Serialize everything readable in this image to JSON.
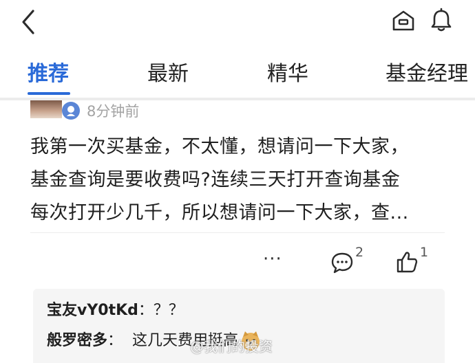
{
  "header": {
    "back_icon": "chevron-left-icon",
    "home_icon": "home-icon",
    "bell_icon": "bell-icon"
  },
  "tabs": [
    {
      "label": "推荐",
      "active": true
    },
    {
      "label": "最新",
      "active": false
    },
    {
      "label": "精华",
      "active": false
    },
    {
      "label": "基金经理",
      "active": false
    }
  ],
  "colors": {
    "accent": "#2a6ad8",
    "badge": "#5b86d6",
    "muted": "#a3a3a3"
  },
  "post": {
    "time": "8分钟前",
    "lines": [
      "我第一次买基金，不太懂，想请问一下大家，",
      "基金查询是要收费吗?连续三天打开查询基金",
      "每次打开少几千，所以想请问一下大家，查..."
    ],
    "more_label": "···",
    "comment_count": "2",
    "like_count": "1"
  },
  "replies": [
    {
      "author": "宝友vY0tKd",
      "separator": "：",
      "text": "？？"
    },
    {
      "author": "般罗密多",
      "separator": "：",
      "text": "这几天费用挺高",
      "emoji": "doge-emoji"
    }
  ],
  "watermark": "@我们的投资"
}
